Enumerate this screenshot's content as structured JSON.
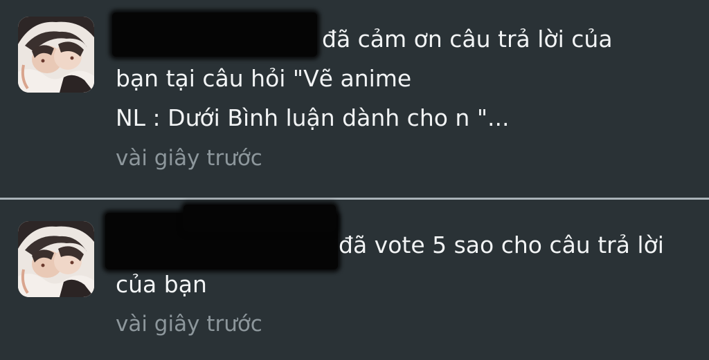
{
  "notifications": [
    {
      "avatar_icon": "user-avatar-icon",
      "message_lines": [
        "đã cảm ơn câu trả lời của",
        "bạn tại câu hỏi \"Vẽ anime",
        "NL : Dưới Bình luận dành cho n \"..."
      ],
      "time": "vài giây trước"
    },
    {
      "avatar_icon": "user-avatar-icon",
      "message_lines": [
        "đã vote 5 sao cho câu trả lời",
        "của bạn"
      ],
      "time": "vài giây trước"
    }
  ],
  "colors": {
    "background": "#2a3236",
    "text": "#f2f4f5",
    "muted_text": "#8d979c",
    "divider": "#aab3b8"
  }
}
